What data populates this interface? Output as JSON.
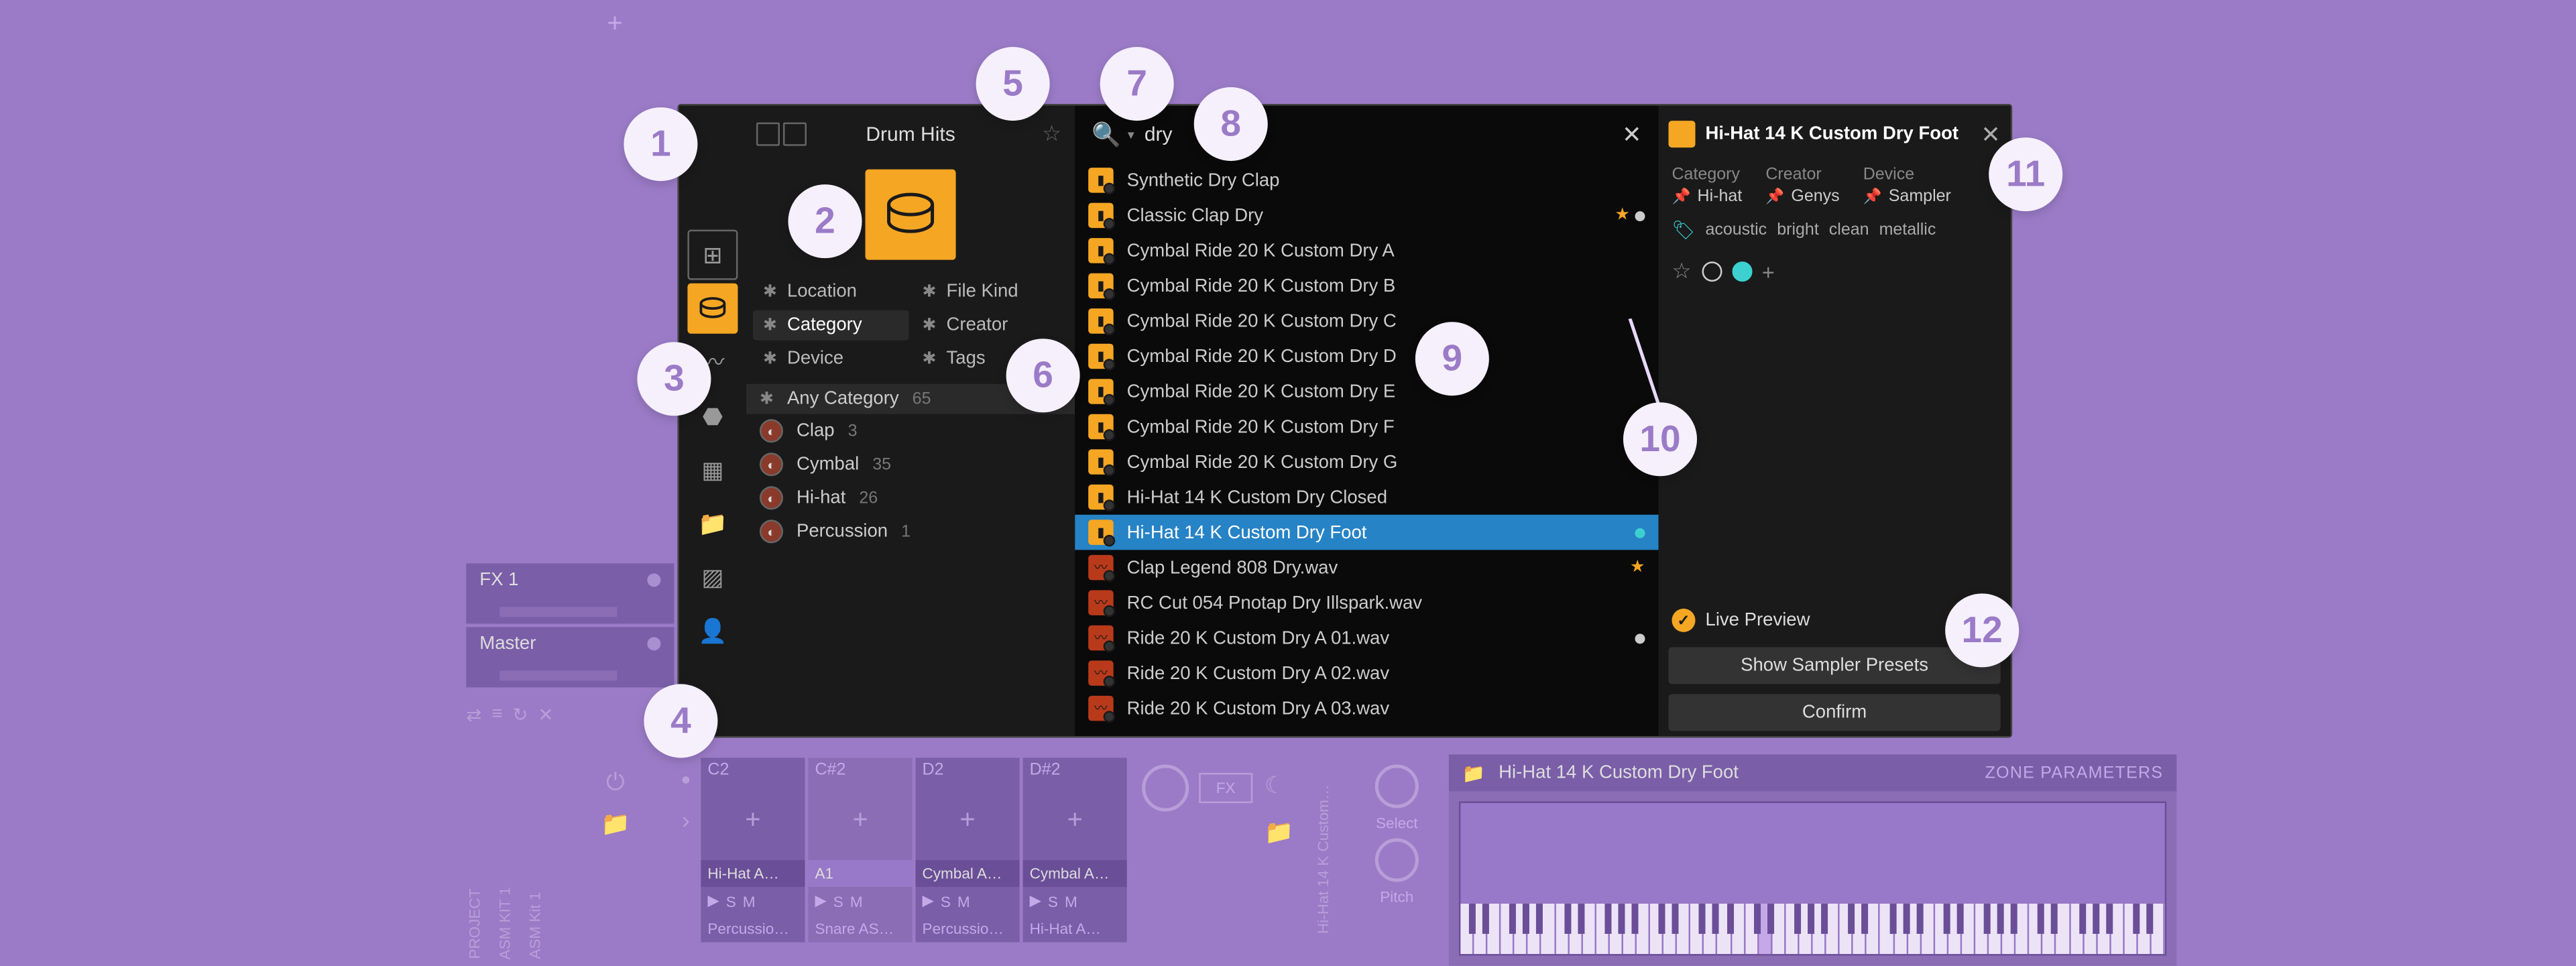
{
  "callouts": [
    "1",
    "2",
    "3",
    "4",
    "5",
    "6",
    "7",
    "8",
    "9",
    "10",
    "11",
    "12"
  ],
  "browser": {
    "title": "Drum Hits",
    "search_value": "dry",
    "filters": {
      "left": [
        "Location",
        "Category",
        "Device"
      ],
      "right": [
        "File Kind",
        "Creator",
        "Tags"
      ],
      "active": "Category"
    },
    "any_category": {
      "label": "Any Category",
      "count": "65"
    },
    "categories": [
      {
        "name": "Clap",
        "count": "3"
      },
      {
        "name": "Cymbal",
        "count": "35"
      },
      {
        "name": "Hi-hat",
        "count": "26"
      },
      {
        "name": "Percussion",
        "count": "1"
      }
    ],
    "results": [
      {
        "name": "Synthetic Dry Clap",
        "icon": "sample"
      },
      {
        "name": "Classic Clap Dry",
        "icon": "sample",
        "marks": [
          "star",
          "dot"
        ]
      },
      {
        "name": "Cymbal Ride 20 K Custom Dry A",
        "icon": "sample"
      },
      {
        "name": "Cymbal Ride 20 K Custom Dry B",
        "icon": "sample"
      },
      {
        "name": "Cymbal Ride 20 K Custom Dry C",
        "icon": "sample"
      },
      {
        "name": "Cymbal Ride 20 K Custom Dry D",
        "icon": "sample"
      },
      {
        "name": "Cymbal Ride 20 K Custom Dry E",
        "icon": "sample"
      },
      {
        "name": "Cymbal Ride 20 K Custom Dry F",
        "icon": "sample"
      },
      {
        "name": "Cymbal Ride 20 K Custom Dry G",
        "icon": "sample"
      },
      {
        "name": "Hi-Hat 14 K Custom Dry Closed",
        "icon": "sample"
      },
      {
        "name": "Hi-Hat 14 K Custom Dry Foot",
        "icon": "sample",
        "selected": true,
        "marks": [
          "cyan"
        ]
      },
      {
        "name": "Clap Legend 808 Dry.wav",
        "icon": "wav",
        "marks": [
          "star"
        ]
      },
      {
        "name": "RC Cut 054 Pnotap Dry Illspark.wav",
        "icon": "wav"
      },
      {
        "name": "Ride 20 K Custom Dry A 01.wav",
        "icon": "wav",
        "marks": [
          "dot"
        ]
      },
      {
        "name": "Ride 20 K Custom Dry A 02.wav",
        "icon": "wav"
      },
      {
        "name": "Ride 20 K Custom Dry A 03.wav",
        "icon": "wav"
      }
    ]
  },
  "detail": {
    "title": "Hi-Hat 14 K Custom Dry Foot",
    "props": {
      "category_label": "Category",
      "category_value": "Hi-hat",
      "creator_label": "Creator",
      "creator_value": "Genys",
      "device_label": "Device",
      "device_value": "Sampler"
    },
    "tags": [
      "acoustic",
      "bright",
      "clean",
      "metallic"
    ],
    "live_preview": "Live Preview",
    "btn_presets": "Show Sampler Presets",
    "btn_confirm": "Confirm"
  },
  "tracks": {
    "track1": "FX 1",
    "track2": "Master"
  },
  "cells": {
    "notes": [
      "C2",
      "C#2",
      "D2",
      "D#2"
    ],
    "names": [
      "Hi-Hat A…",
      "A1",
      "Cymbal A…",
      "Cymbal A…"
    ],
    "perc": [
      "Percussio…",
      "Snare AS…",
      "Percussio…",
      "Hi-Hat A…"
    ]
  },
  "bottom": {
    "fx": "FX",
    "select": "Select",
    "pitch": "Pitch",
    "vert_labels": [
      "PROJECT",
      "ASM KIT 1",
      "ASM Kit 1",
      "Hi-Hat 14 K Custom…"
    ]
  },
  "sampler": {
    "title": "Hi-Hat 14 K Custom Dry Foot",
    "zone": "ZONE PARAMETERS"
  }
}
